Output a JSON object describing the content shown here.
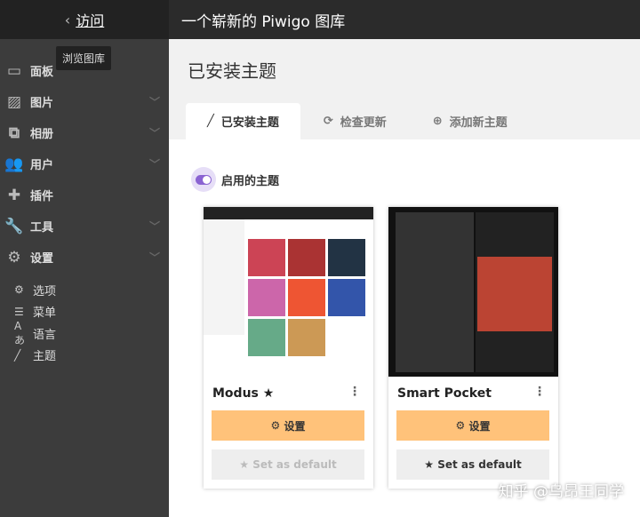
{
  "sidebar": {
    "visit": "访问",
    "tooltip": "浏览图库",
    "items": [
      {
        "label": "面板",
        "icon": "monitor-icon",
        "chev": false
      },
      {
        "label": "图片",
        "icon": "image-icon",
        "chev": true
      },
      {
        "label": "相册",
        "icon": "sitemap-icon",
        "chev": true
      },
      {
        "label": "用户",
        "icon": "users-icon",
        "chev": true
      },
      {
        "label": "插件",
        "icon": "puzzle-icon",
        "chev": false
      },
      {
        "label": "工具",
        "icon": "wrench-icon",
        "chev": true
      },
      {
        "label": "设置",
        "icon": "gear-icon",
        "chev": true
      }
    ],
    "subitems": [
      {
        "label": "选项",
        "icon": "gears-icon"
      },
      {
        "label": "菜单",
        "icon": "menu-icon"
      },
      {
        "label": "语言",
        "icon": "language-icon"
      },
      {
        "label": "主题",
        "icon": "brush-icon"
      }
    ]
  },
  "header": {
    "title": "一个崭新的 Piwigo 图库"
  },
  "page": {
    "title": "已安装主题",
    "tabs": [
      "已安装主题",
      "检查更新",
      "添加新主题"
    ],
    "enabled_label": "启用的主题"
  },
  "themes": [
    {
      "name": "Modus",
      "settings": "设置",
      "default": "Set as default",
      "star": "★"
    },
    {
      "name": "Smart Pocket",
      "settings": "设置",
      "default": "Set as default"
    }
  ],
  "watermark": "知乎 @乌昂王同学"
}
